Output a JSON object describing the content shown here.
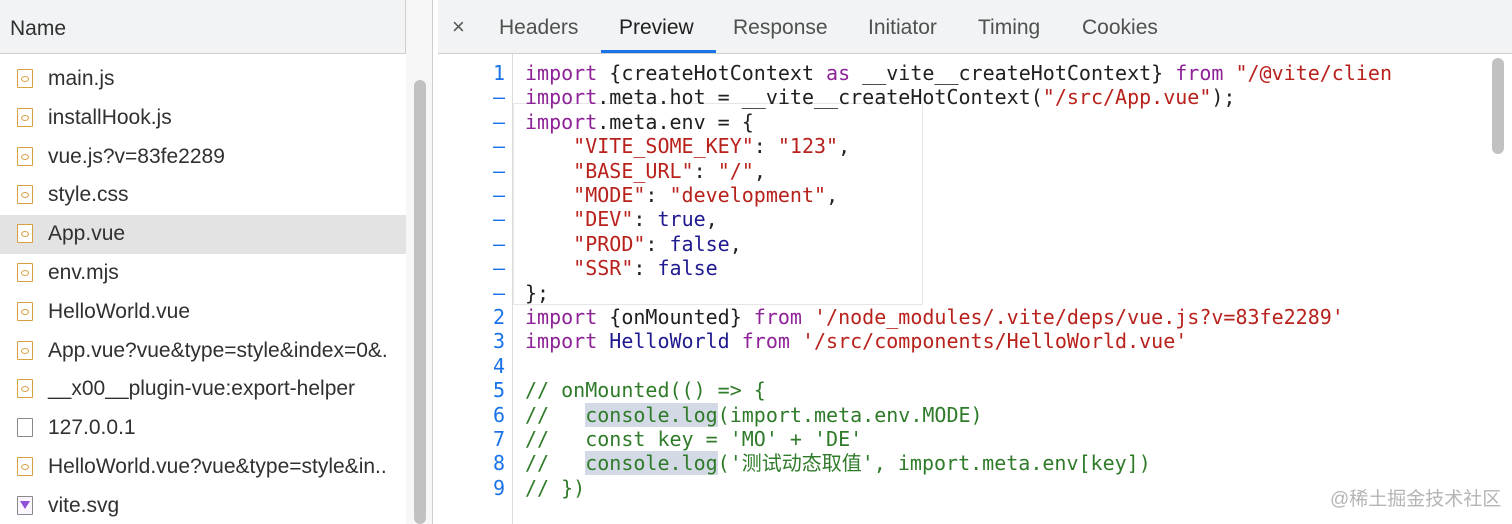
{
  "left_panel": {
    "header": "Name",
    "files": [
      {
        "name": "main.js",
        "icon": "js-file-icon"
      },
      {
        "name": "installHook.js",
        "icon": "js-file-icon"
      },
      {
        "name": "vue.js?v=83fe2289",
        "icon": "js-file-icon"
      },
      {
        "name": "style.css",
        "icon": "css-file-icon"
      },
      {
        "name": "App.vue",
        "icon": "js-file-icon",
        "selected": true
      },
      {
        "name": "env.mjs",
        "icon": "js-file-icon"
      },
      {
        "name": "HelloWorld.vue",
        "icon": "js-file-icon"
      },
      {
        "name": "App.vue?vue&type=style&index=0&.",
        "icon": "js-file-icon"
      },
      {
        "name": "__x00__plugin-vue:export-helper",
        "icon": "js-file-icon"
      },
      {
        "name": "127.0.0.1",
        "icon": "document-icon"
      },
      {
        "name": "HelloWorld.vue?vue&type=style&in..",
        "icon": "js-file-icon"
      },
      {
        "name": "vite.svg",
        "icon": "svg-file-icon"
      }
    ]
  },
  "tabs": {
    "close": "×",
    "items": [
      "Headers",
      "Preview",
      "Response",
      "Initiator",
      "Timing",
      "Cookies"
    ],
    "active": "Preview"
  },
  "code": {
    "line_numbers": [
      "1",
      "–",
      "–",
      "–",
      "–",
      "–",
      "–",
      "–",
      "–",
      "–",
      "2",
      "3",
      "4",
      "5",
      "6",
      "7",
      "8",
      "9"
    ],
    "lines": [
      [
        "import",
        " {createHotContext ",
        "as",
        " __vite__createHotContext} ",
        "from",
        " \"/@vite/clien"
      ],
      [
        "import",
        ".meta.hot = __vite__createHotContext(",
        "\"/src/App.vue\"",
        ");"
      ],
      [
        "import",
        ".meta.env = {"
      ],
      [
        "    ",
        "\"VITE_SOME_KEY\"",
        ": ",
        "\"123\"",
        ","
      ],
      [
        "    ",
        "\"BASE_URL\"",
        ": ",
        "\"/\"",
        ","
      ],
      [
        "    ",
        "\"MODE\"",
        ": ",
        "\"development\"",
        ","
      ],
      [
        "    ",
        "\"DEV\"",
        ": ",
        "true",
        ","
      ],
      [
        "    ",
        "\"PROD\"",
        ": ",
        "false",
        ","
      ],
      [
        "    ",
        "\"SSR\"",
        ": ",
        "false"
      ],
      [
        "};"
      ],
      [
        "import",
        " {onMounted} ",
        "from",
        " '/node_modules/.vite/deps/vue.js?v=83fe2289'"
      ],
      [
        "import",
        " ",
        "HelloWorld",
        " ",
        "from",
        " '/src/components/HelloWorld.vue'"
      ],
      [
        ""
      ],
      [
        "// onMounted(() => {"
      ],
      [
        "//   ",
        "console.log",
        "(import.meta.env.MODE)"
      ],
      [
        "//   const key = 'MO' + 'DE'"
      ],
      [
        "//   ",
        "console.log",
        "('测试动态取值', import.meta.env[key])"
      ],
      [
        "// })"
      ]
    ]
  },
  "watermark": "@稀土掘金技术社区",
  "colors": {
    "accent": "#1a73e8",
    "keyword": "#8e2297",
    "string": "#b8211c",
    "boolean": "#1f1a8f",
    "comment": "#2f7b2a"
  }
}
